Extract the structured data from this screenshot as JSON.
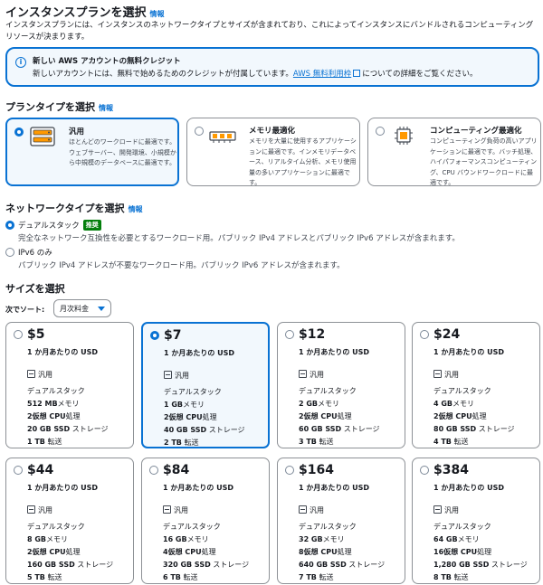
{
  "header": {
    "title": "インスタンスプランを選択",
    "info": "情報",
    "description": "インスタンスプランには、インスタンスのネットワークタイプとサイズが含まれており、これによってインスタンスにバンドルされるコンピューティングリソースが決まります。"
  },
  "alert": {
    "icon": "info-icon",
    "title": "新しい AWS アカウントの無料クレジット",
    "body_prefix": "新しいアカウントには、無料で始めるためのクレジットが付属しています。",
    "link": "AWS 無料利用枠",
    "body_suffix": "についての詳細をご覧ください。",
    "accent": "#0972d3"
  },
  "plan_type": {
    "heading": "プランタイプを選択",
    "info": "情報",
    "options": [
      {
        "title": "汎用",
        "desc": "ほとんどのワークロードに最適です。ウェブサーバー、開発環境、小規模から中規模のデータベースに最適です。",
        "icon": "server-rack-icon",
        "selected": true
      },
      {
        "title": "メモリ最適化",
        "desc": "メモリを大量に使用するアプリケーションに最適です。インメモリデータベース、リアルタイム分析、メモリ使用量の多いアプリケーションに最適です。",
        "icon": "memory-chip-icon",
        "selected": false
      },
      {
        "title": "コンピューティング最適化",
        "desc": "コンピューティング負荷の高いアプリケーションに最適です。バッチ処理、ハイパフォーマンスコンピューティング、CPU バウンドワークロードに最適です。",
        "icon": "cpu-chip-icon",
        "selected": false
      }
    ]
  },
  "network": {
    "heading": "ネットワークタイプを選択",
    "info": "情報",
    "options": [
      {
        "title": "デュアルスタック",
        "badge": "推奨",
        "desc": "完全なネットワーク互換性を必要とするワークロード用。パブリック IPv4 アドレスとパブリック IPv6 アドレスが含まれます。",
        "selected": true
      },
      {
        "title": "IPv6 のみ",
        "badge": "",
        "desc": "パブリック IPv4 アドレスが不要なワークロード用。パブリック IPv6 アドレスが含まれます。",
        "selected": false
      }
    ]
  },
  "size": {
    "heading": "サイズを選択",
    "sort_label": "次でソート:",
    "sort_value": "月次料金",
    "per_label": "1 か月あたりの USD",
    "type_label": "汎用",
    "stack_label": "デュアルスタック",
    "cards": [
      {
        "price": "$5",
        "mem_val": "512 MB",
        "mem_unit": "メモリ",
        "cpu_val": "2仮想 CPU",
        "cpu_unit": "処理",
        "ssd_val": "20 GB SSD",
        "ssd_unit": "ストレージ",
        "xfer_val": "1 TB",
        "xfer_unit": "転送",
        "selected": false
      },
      {
        "price": "$7",
        "mem_val": "1 GB",
        "mem_unit": "メモリ",
        "cpu_val": "2仮想 CPU",
        "cpu_unit": "処理",
        "ssd_val": "40 GB SSD",
        "ssd_unit": "ストレージ",
        "xfer_val": "2 TB",
        "xfer_unit": "転送",
        "selected": true
      },
      {
        "price": "$12",
        "mem_val": "2 GB",
        "mem_unit": "メモリ",
        "cpu_val": "2仮想 CPU",
        "cpu_unit": "処理",
        "ssd_val": "60 GB SSD",
        "ssd_unit": "ストレージ",
        "xfer_val": "3 TB",
        "xfer_unit": "転送",
        "selected": false
      },
      {
        "price": "$24",
        "mem_val": "4 GB",
        "mem_unit": "メモリ",
        "cpu_val": "2仮想 CPU",
        "cpu_unit": "処理",
        "ssd_val": "80 GB SSD",
        "ssd_unit": "ストレージ",
        "xfer_val": "4 TB",
        "xfer_unit": "転送",
        "selected": false
      },
      {
        "price": "$44",
        "mem_val": "8 GB",
        "mem_unit": "メモリ",
        "cpu_val": "2仮想 CPU",
        "cpu_unit": "処理",
        "ssd_val": "160 GB SSD",
        "ssd_unit": "ストレージ",
        "xfer_val": "5 TB",
        "xfer_unit": "転送",
        "selected": false
      },
      {
        "price": "$84",
        "mem_val": "16 GB",
        "mem_unit": "メモリ",
        "cpu_val": "4仮想 CPU",
        "cpu_unit": "処理",
        "ssd_val": "320 GB SSD",
        "ssd_unit": "ストレージ",
        "xfer_val": "6 TB",
        "xfer_unit": "転送",
        "selected": false
      },
      {
        "price": "$164",
        "mem_val": "32 GB",
        "mem_unit": "メモリ",
        "cpu_val": "8仮想 CPU",
        "cpu_unit": "処理",
        "ssd_val": "640 GB SSD",
        "ssd_unit": "ストレージ",
        "xfer_val": "7 TB",
        "xfer_unit": "転送",
        "selected": false
      },
      {
        "price": "$384",
        "mem_val": "64 GB",
        "mem_unit": "メモリ",
        "cpu_val": "16仮想 CPU",
        "cpu_unit": "処理",
        "ssd_val": "1,280 GB SSD",
        "ssd_unit": "ストレージ",
        "xfer_val": "8 TB",
        "xfer_unit": "転送",
        "selected": false
      }
    ]
  }
}
